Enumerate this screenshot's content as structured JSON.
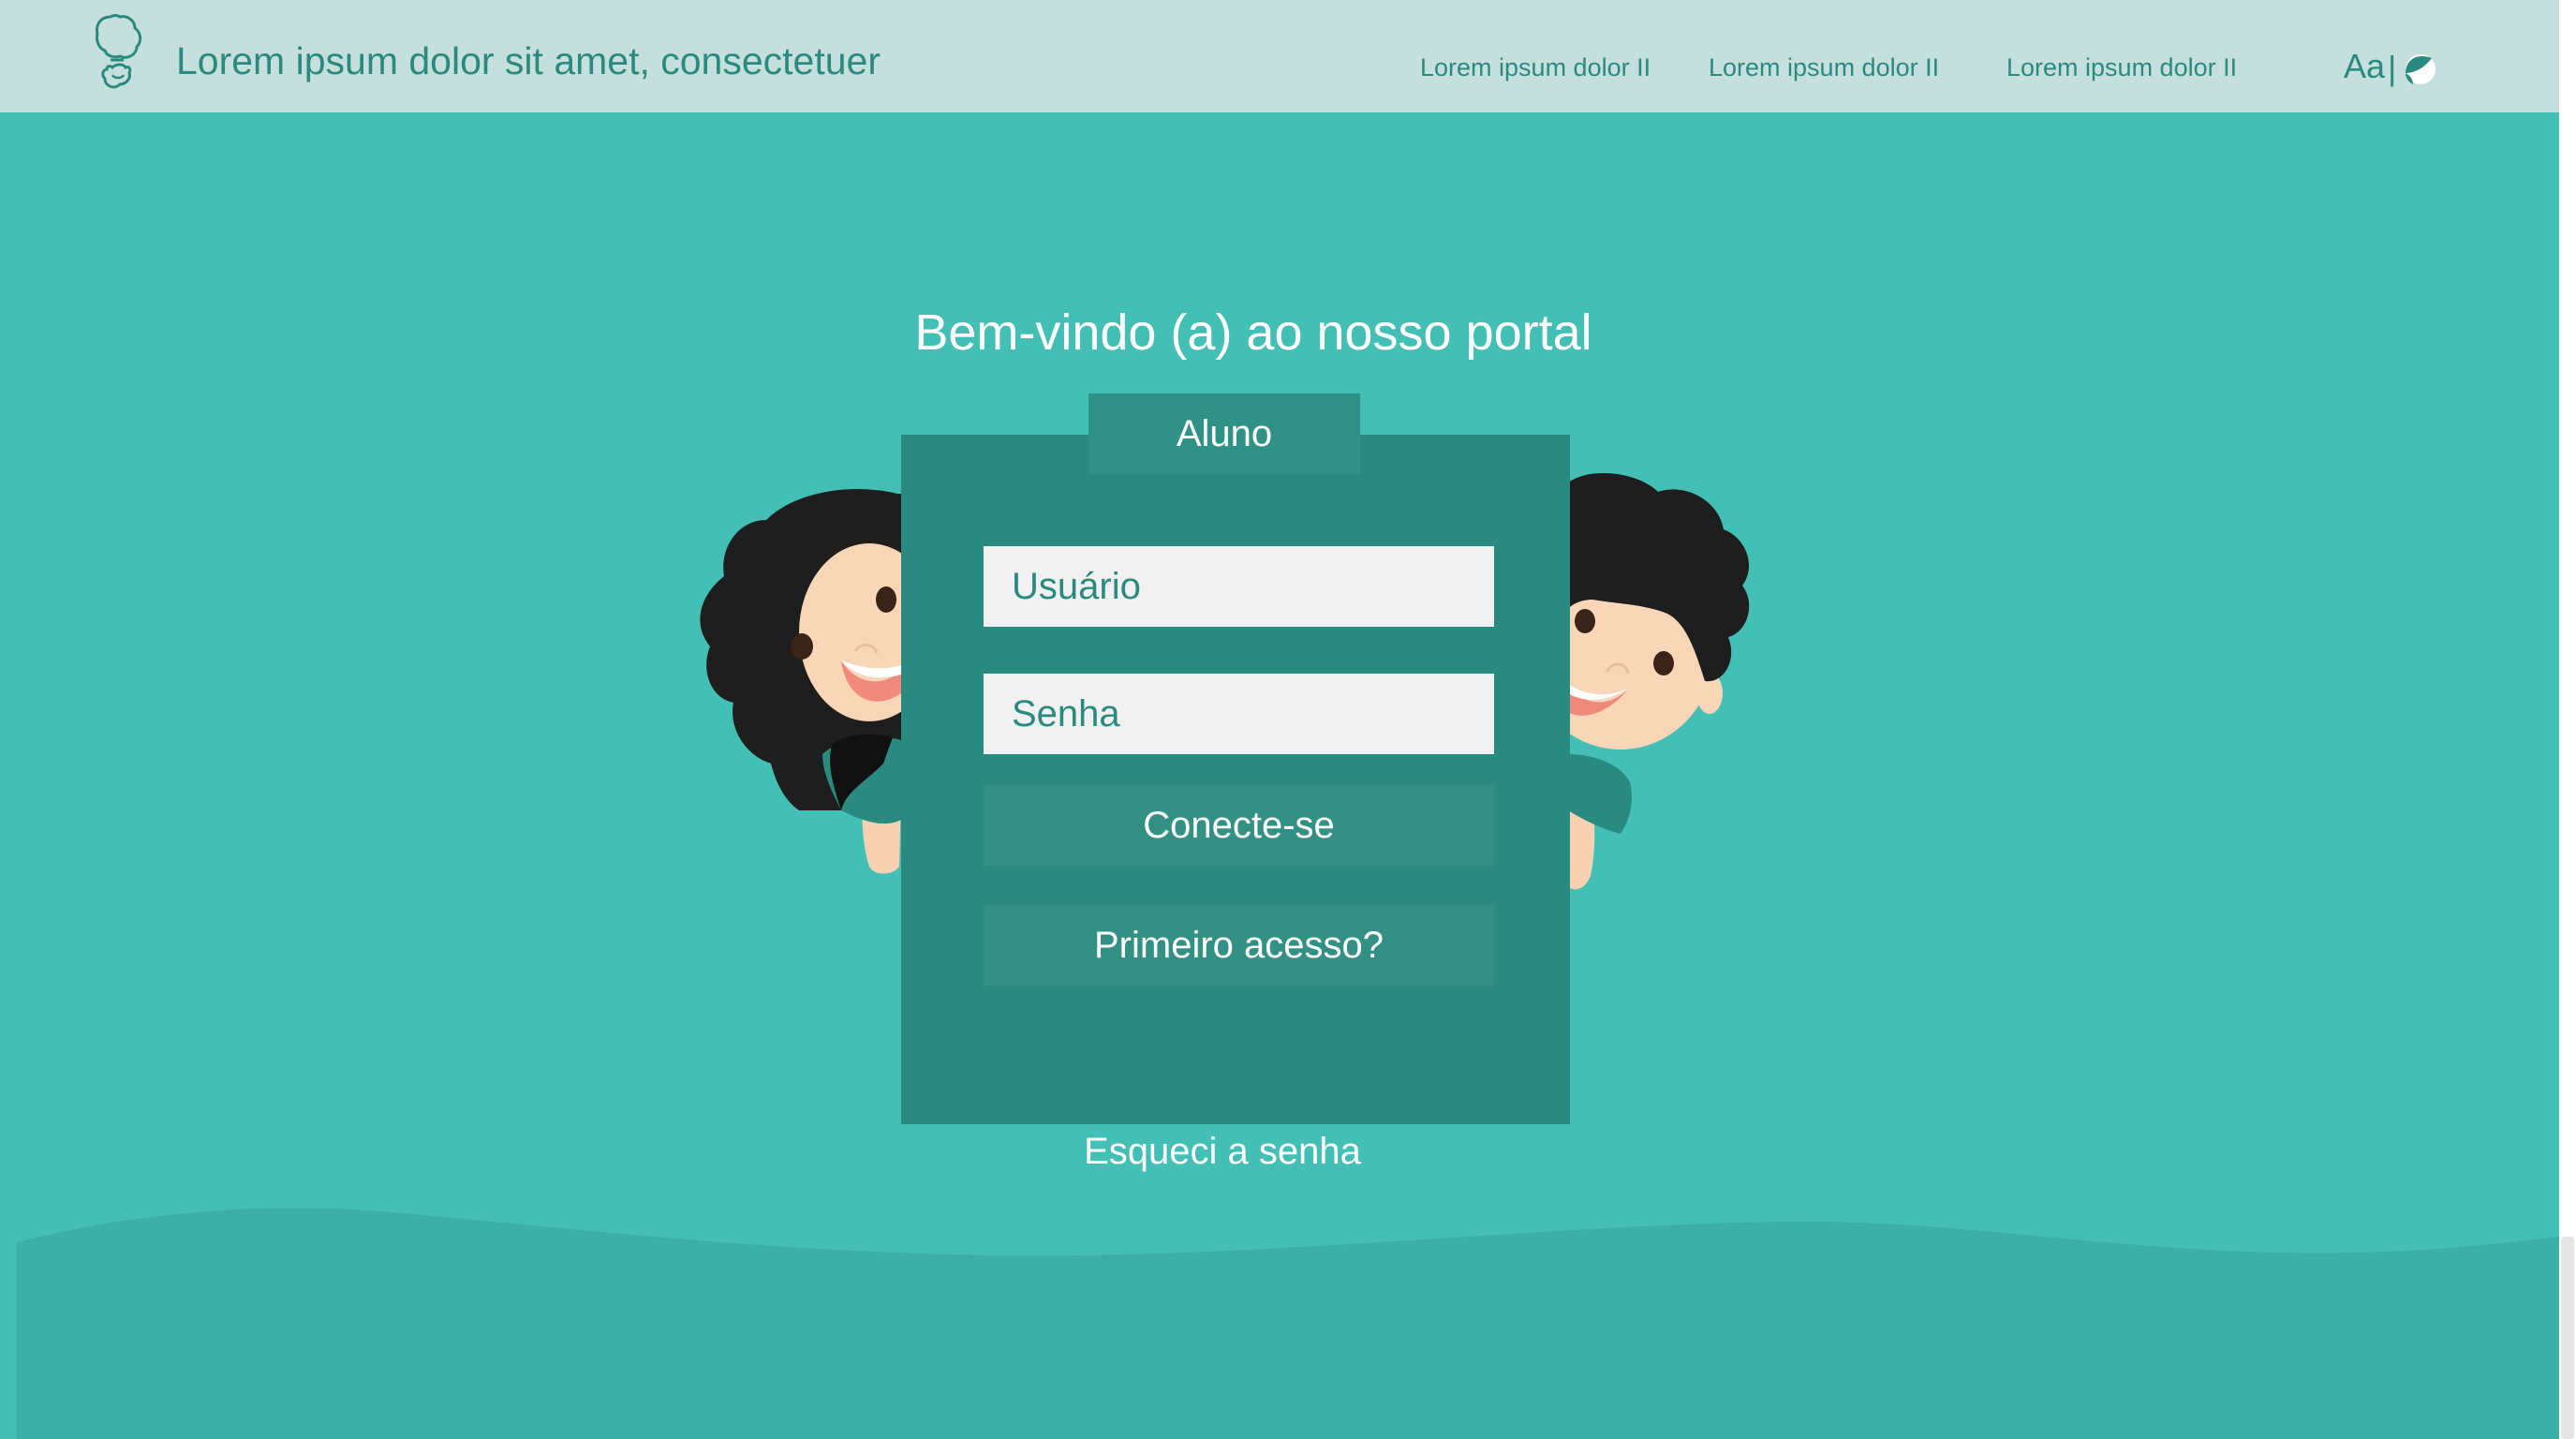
{
  "header": {
    "title": "Lorem ipsum dolor sit amet, consectetuer",
    "nav": [
      {
        "label": "Lorem ipsum dolor II"
      },
      {
        "label": "Lorem ipsum dolor II"
      },
      {
        "label": "Lorem ipsum dolor II"
      }
    ],
    "font_toggle": "Aa",
    "separator": "|"
  },
  "main": {
    "welcome": "Bem-vindo (a) ao nosso portal",
    "tab_label": "Aluno",
    "username_placeholder": "Usuário",
    "password_placeholder": "Senha",
    "login_label": "Conecte-se",
    "first_access_label": "Primeiro acesso?",
    "forgot_label": "Esqueci a senha"
  },
  "icons": [
    "logo-icon",
    "contrast-icon"
  ],
  "colors": {
    "background": "#44bfb5",
    "header": "#c5e0dc",
    "panel": "#2a8a80",
    "button": "#339085",
    "input": "#f1f1f1",
    "wave": "#3cafa6"
  }
}
